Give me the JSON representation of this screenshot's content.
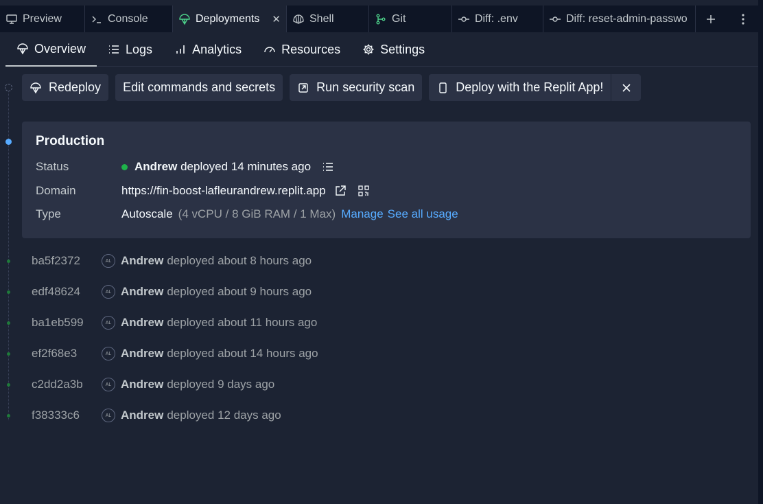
{
  "tabs": [
    {
      "label": "Preview",
      "icon": "monitor-icon"
    },
    {
      "label": "Console",
      "icon": "terminal-icon"
    },
    {
      "label": "Deployments",
      "icon": "deployments-icon",
      "active": true
    },
    {
      "label": "Shell",
      "icon": "shell-icon"
    },
    {
      "label": "Git",
      "icon": "git-icon"
    },
    {
      "label": "Diff: .env",
      "icon": "commit-icon"
    },
    {
      "label": "Diff: reset-admin-passwo",
      "icon": "commit-icon"
    }
  ],
  "subnav": [
    {
      "label": "Overview",
      "icon": "deployments-icon"
    },
    {
      "label": "Logs",
      "icon": "list-icon"
    },
    {
      "label": "Analytics",
      "icon": "bar-chart-icon"
    },
    {
      "label": "Resources",
      "icon": "gauge-icon"
    },
    {
      "label": "Settings",
      "icon": "gear-icon"
    }
  ],
  "actions": {
    "redeploy": "Redeploy",
    "edit": "Edit commands and secrets",
    "scan": "Run security scan",
    "mobile": "Deploy with the Replit App!"
  },
  "production": {
    "title": "Production",
    "status_label": "Status",
    "status_user": "Andrew",
    "status_text": "deployed 14 minutes ago",
    "domain_label": "Domain",
    "domain": "https://fin-boost-lafleurandrew.replit.app",
    "type_label": "Type",
    "type": "Autoscale",
    "type_detail": "(4 vCPU / 8 GiB RAM / 1 Max)",
    "manage": "Manage",
    "usage": "See all usage"
  },
  "history": [
    {
      "hash": "ba5f2372",
      "initials": "AL",
      "user": "Andrew",
      "text": "deployed about 8 hours ago"
    },
    {
      "hash": "edf48624",
      "initials": "AL",
      "user": "Andrew",
      "text": "deployed about 9 hours ago"
    },
    {
      "hash": "ba1eb599",
      "initials": "AL",
      "user": "Andrew",
      "text": "deployed about 11 hours ago"
    },
    {
      "hash": "ef2f68e3",
      "initials": "AL",
      "user": "Andrew",
      "text": "deployed about 14 hours ago"
    },
    {
      "hash": "c2dd2a3b",
      "initials": "AL",
      "user": "Andrew",
      "text": "deployed 9 days ago"
    },
    {
      "hash": "f38333c6",
      "initials": "AL",
      "user": "Andrew",
      "text": "deployed 12 days ago"
    }
  ],
  "colors": {
    "accent": "#57abff",
    "status_green": "#1eb24a",
    "background": "#1c2333",
    "surface": "#2b3245"
  }
}
